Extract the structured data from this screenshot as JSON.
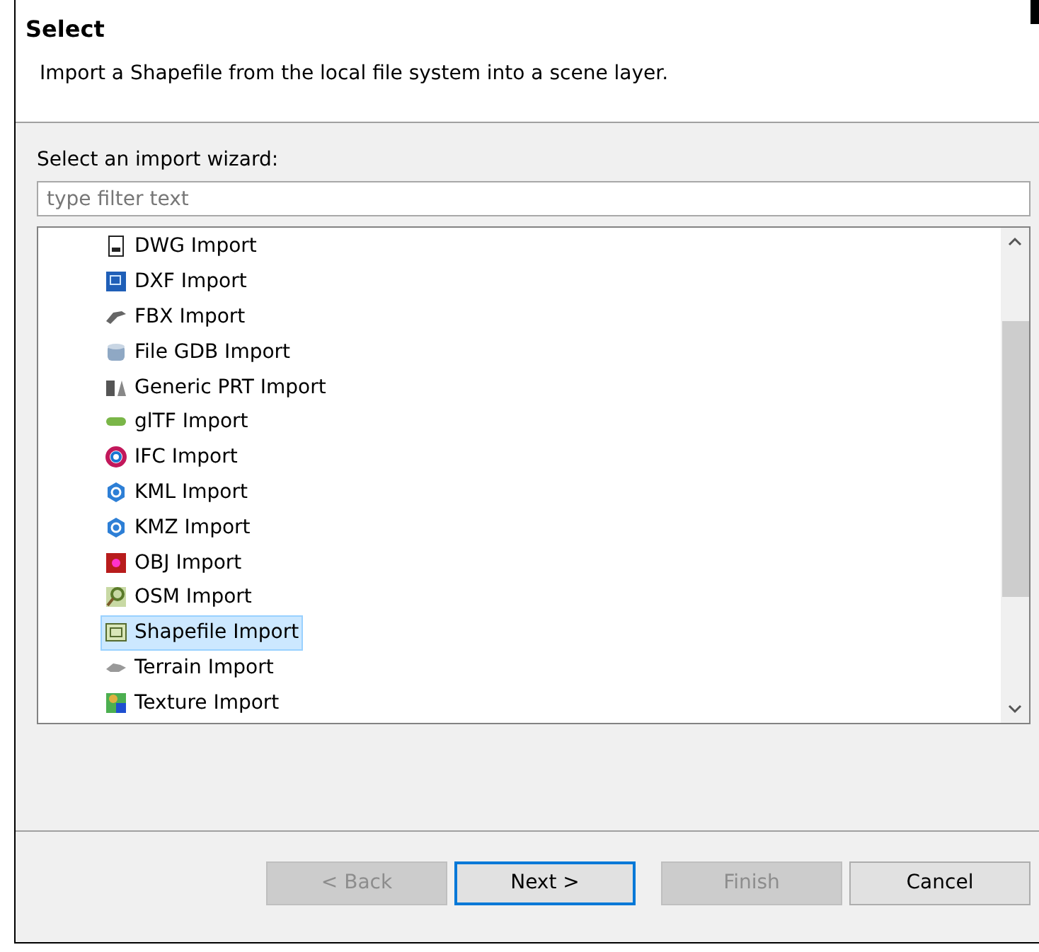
{
  "header": {
    "title": "Select",
    "description": "Import a Shapefile from the local file system into a scene layer."
  },
  "wizard_label": "Select an import wizard:",
  "filter": {
    "placeholder": "type filter text"
  },
  "items": [
    {
      "label": "DWG Import",
      "selected": false
    },
    {
      "label": "DXF Import",
      "selected": false
    },
    {
      "label": "FBX Import",
      "selected": false
    },
    {
      "label": "File GDB Import",
      "selected": false
    },
    {
      "label": "Generic PRT Import",
      "selected": false
    },
    {
      "label": "glTF Import",
      "selected": false
    },
    {
      "label": "IFC Import",
      "selected": false
    },
    {
      "label": "KML Import",
      "selected": false
    },
    {
      "label": "KMZ Import",
      "selected": false
    },
    {
      "label": "OBJ Import",
      "selected": false
    },
    {
      "label": "OSM Import",
      "selected": false
    },
    {
      "label": "Shapefile Import",
      "selected": true
    },
    {
      "label": "Terrain Import",
      "selected": false
    },
    {
      "label": "Texture Import",
      "selected": false
    }
  ],
  "buttons": [
    {
      "label": "< Back",
      "disabled": true,
      "default": false
    },
    {
      "label": "Next >",
      "disabled": false,
      "default": true
    },
    {
      "label": "Finish",
      "disabled": true,
      "default": false
    },
    {
      "label": "Cancel",
      "disabled": false,
      "default": false
    }
  ]
}
